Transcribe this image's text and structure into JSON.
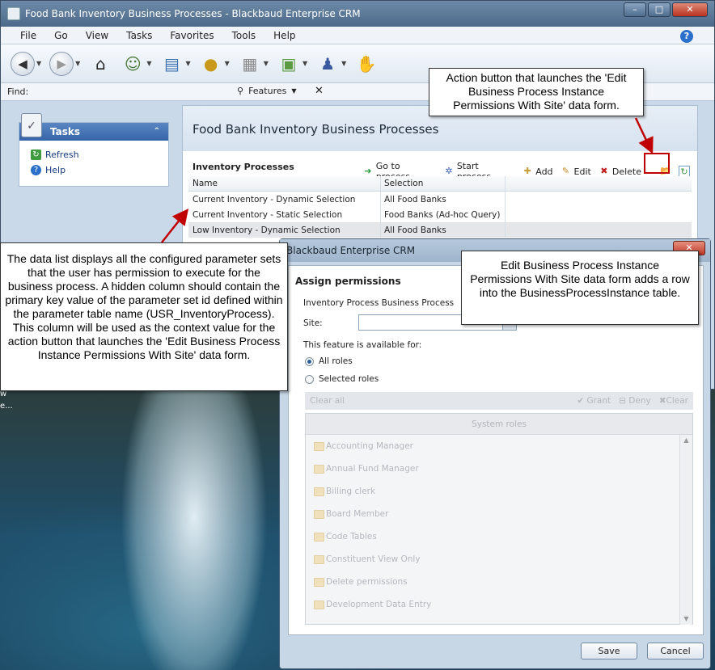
{
  "window": {
    "title": "Food Bank Inventory Business Processes - Blackbaud Enterprise CRM",
    "controls": [
      "–",
      "□",
      "✕"
    ]
  },
  "menu": [
    "File",
    "Go",
    "View",
    "Tasks",
    "Favorites",
    "Tools",
    "Help"
  ],
  "toolbar_icons": [
    "back-icon",
    "forward-icon",
    "home-icon",
    "constituents-icon",
    "marketing-icon",
    "revenue-icon",
    "cash-register-icon",
    "calendar-icon",
    "people-icon",
    "volunteer-icon",
    "events-icon",
    "thermometer-icon",
    "admin-icon"
  ],
  "find": {
    "label": "Find:",
    "features_label": "Features",
    "clear": "✕"
  },
  "tasks_panel": {
    "title": "Tasks",
    "items": [
      "Refresh",
      "Help"
    ]
  },
  "page": {
    "title": "Food Bank Inventory Business Processes",
    "section_title": "Inventory Processes",
    "actions": [
      "Go to process",
      "Start process",
      "Add",
      "Edit",
      "Delete"
    ]
  },
  "grid": {
    "columns": [
      "Name",
      "Selection"
    ],
    "rows": [
      {
        "name": "Current Inventory - Dynamic Selection",
        "selection": "All Food Banks"
      },
      {
        "name": "Current Inventory - Static Selection",
        "selection": "Food Banks (Ad-hoc Query)"
      },
      {
        "name": "Low Inventory - Dynamic Selection",
        "selection": "All Food Banks"
      }
    ]
  },
  "dialog": {
    "title": "Blackbaud Enterprise CRM",
    "close": "✕",
    "heading": "Assign permissions",
    "process_label": "Inventory Process Business Process",
    "site_label": "Site:",
    "site_value": "",
    "availability_label": "This feature is available for:",
    "radio_all": "All roles",
    "radio_selected": "Selected roles",
    "clear_all": "Clear all",
    "grant": "Grant",
    "deny": "Deny",
    "clear": "Clear",
    "roles_header": "System roles",
    "roles": [
      "Accounting Manager",
      "Annual Fund Manager",
      "Billing clerk",
      "Board Member",
      "Code Tables",
      "Constituent View Only",
      "Delete permissions",
      "Development Data Entry"
    ],
    "save": "Save",
    "cancel": "Cancel"
  },
  "callouts": {
    "action_button": "Action button that launches the 'Edit Business Process Instance Permissions With Site' data form.",
    "data_list": "The data list displays all the configured parameter sets that the user has permission to execute for the business process.  A hidden column should contain the primary key value of the parameter set id defined within the parameter table name (USR_InventoryProcess).   This column will be used as the context value for the action button that launches the 'Edit Business Process Instance Permissions With Site' data form.",
    "data_form": "Edit Business Process Instance Permissions With Site data form adds a row into the BusinessProcessInstance table."
  },
  "desktop_text": [
    "w",
    "e..."
  ],
  "colors": {
    "accent": "#3565a8",
    "callout_arrow": "#c00000"
  }
}
